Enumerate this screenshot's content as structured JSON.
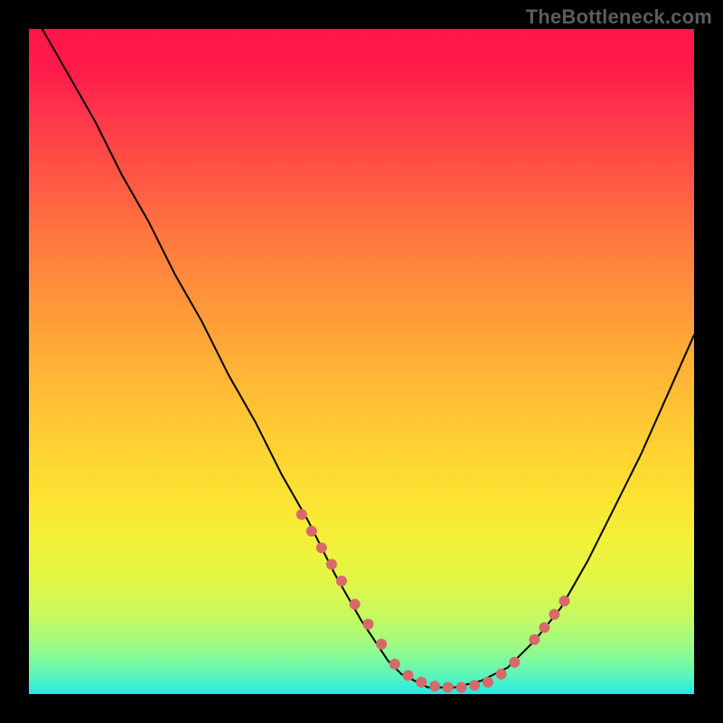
{
  "watermark": "TheBottleneck.com",
  "chart_data": {
    "type": "line",
    "title": "",
    "xlabel": "",
    "ylabel": "",
    "xlim": [
      0,
      100
    ],
    "ylim": [
      0,
      100
    ],
    "grid": false,
    "legend": false,
    "series": [
      {
        "name": "curve",
        "color": "#000000",
        "x": [
          2,
          6,
          10,
          14,
          18,
          22,
          26,
          30,
          34,
          38,
          42,
          46,
          50,
          52,
          54,
          56,
          58,
          60,
          62,
          64,
          68,
          72,
          76,
          80,
          84,
          88,
          92,
          96,
          100
        ],
        "y": [
          100,
          93,
          86,
          78,
          71,
          63,
          56,
          48,
          41,
          33,
          26,
          18,
          11,
          8,
          5,
          3,
          2,
          1,
          1,
          1,
          2,
          4,
          8,
          13,
          20,
          28,
          36,
          45,
          54
        ]
      }
    ],
    "markers": {
      "name": "threshold-dots",
      "color": "#d66a6a",
      "radius_px": 6,
      "x": [
        41,
        42.5,
        44,
        45.5,
        47,
        49,
        51,
        53,
        55,
        57,
        59,
        61,
        63,
        65,
        67,
        69,
        71,
        73,
        76,
        77.5,
        79,
        80.5
      ],
      "y": [
        27,
        24.5,
        22,
        19.5,
        17,
        13.5,
        10.5,
        7.5,
        4.5,
        2.8,
        1.8,
        1.2,
        1,
        1,
        1.3,
        1.8,
        3,
        4.8,
        8.2,
        10,
        12,
        14
      ]
    },
    "background_gradient": {
      "direction": "vertical",
      "stops": [
        {
          "pos": 0.0,
          "color": "#ff1647"
        },
        {
          "pos": 0.25,
          "color": "#ff6142"
        },
        {
          "pos": 0.5,
          "color": "#ffb235"
        },
        {
          "pos": 0.75,
          "color": "#f0f239"
        },
        {
          "pos": 0.92,
          "color": "#a5fa7e"
        },
        {
          "pos": 1.0,
          "color": "#22e7e6"
        }
      ]
    }
  }
}
